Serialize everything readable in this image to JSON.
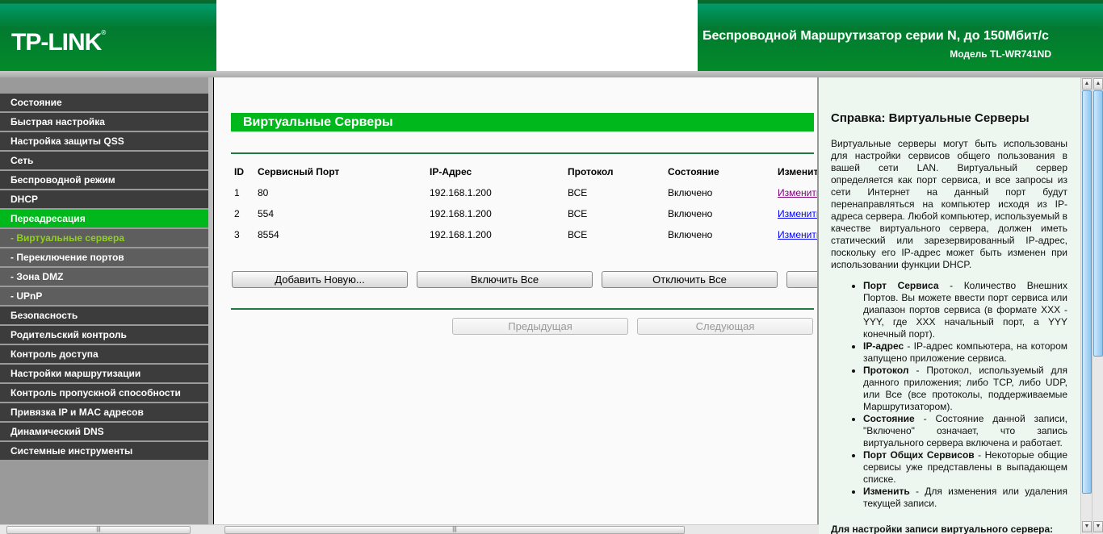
{
  "header": {
    "logo": "TP-LINK",
    "title": "Беспроводной Маршрутизатор серии N, до 150Мбит/с",
    "model": "Модель TL-WR741ND"
  },
  "sidebar": {
    "items": [
      {
        "label": "Состояние",
        "type": "main"
      },
      {
        "label": "Быстрая настройка",
        "type": "main"
      },
      {
        "label": "Настройка защиты QSS",
        "type": "main"
      },
      {
        "label": "Сеть",
        "type": "main"
      },
      {
        "label": "Беспроводной режим",
        "type": "main"
      },
      {
        "label": "DHCP",
        "type": "main"
      },
      {
        "label": "Переадресация",
        "type": "active"
      },
      {
        "label": "- Виртуальные сервера",
        "type": "current"
      },
      {
        "label": "- Переключение портов",
        "type": "sub"
      },
      {
        "label": "- Зона DMZ",
        "type": "sub"
      },
      {
        "label": "- UPnP",
        "type": "sub"
      },
      {
        "label": "Безопасность",
        "type": "main"
      },
      {
        "label": "Родительский контроль",
        "type": "main"
      },
      {
        "label": "Контроль доступа",
        "type": "main"
      },
      {
        "label": "Настройки маршрутизации",
        "type": "main"
      },
      {
        "label": "Контроль пропускной способности",
        "type": "main"
      },
      {
        "label": "Привязка IP и MAC адресов",
        "type": "main"
      },
      {
        "label": "Динамический DNS",
        "type": "main"
      },
      {
        "label": "Системные инструменты",
        "type": "main"
      }
    ]
  },
  "main": {
    "title": "Виртуальные Серверы",
    "columns": [
      "ID",
      "Сервисный Порт",
      "IP-Адрес",
      "Протокол",
      "Состояние",
      "Изменить"
    ],
    "rows": [
      {
        "id": "1",
        "port": "80",
        "ip": "192.168.1.200",
        "protocol": "ВСЕ",
        "status": "Включено",
        "action": "Изменить"
      },
      {
        "id": "2",
        "port": "554",
        "ip": "192.168.1.200",
        "protocol": "ВСЕ",
        "status": "Включено",
        "action": "Изменить"
      },
      {
        "id": "3",
        "port": "8554",
        "ip": "192.168.1.200",
        "protocol": "ВСЕ",
        "status": "Включено",
        "action": "Изменить"
      }
    ],
    "buttons": {
      "add": "Добавить Новую...",
      "enable_all": "Включить Все",
      "disable_all": "Отключить Все",
      "prev": "Предыдущая",
      "next": "Следующая"
    }
  },
  "help": {
    "title": "Справка: Виртуальные Серверы",
    "intro": "Виртуальные серверы могут быть использованы для настройки сервисов общего пользования в вашей сети LAN. Виртуальный сервер определяется как порт сервиса, и все запросы из сети Интернет на данный порт будут перенаправляться на компьютер исходя из IP-адреса сервера. Любой компьютер, используемый в качестве виртуального сервера, должен иметь статический или зарезервированный IP-адрес, поскольку его IP-адрес может быть изменен при использовании функции DHCP.",
    "items": [
      {
        "term": "Порт Сервиса",
        "text": " - Количество Внешних Портов. Вы можете ввести порт сервиса или диапазон портов сервиса (в формате XXX - YYY, где XXX начальный порт, а YYY конечный порт)."
      },
      {
        "term": "IP-адрес",
        "text": " - IP-адрес компьютера, на котором запущено приложение сервиса."
      },
      {
        "term": "Протокол",
        "text": " - Протокол, используемый для данного приложения; либо TCP, либо UDP, или Все (все протоколы, поддерживаемые Маршрутизатором)."
      },
      {
        "term": "Состояние",
        "text": " - Состояние данной записи, \"Включено\" означает, что запись виртуального сервера включена и работает."
      },
      {
        "term": "Порт Общих Сервисов",
        "text": " - Некоторые общие сервисы уже представлены в выпадающем списке."
      },
      {
        "term": "Изменить",
        "text": " - Для изменения или удаления текущей записи."
      }
    ],
    "footer": "Для настройки записи виртуального сервера:"
  }
}
